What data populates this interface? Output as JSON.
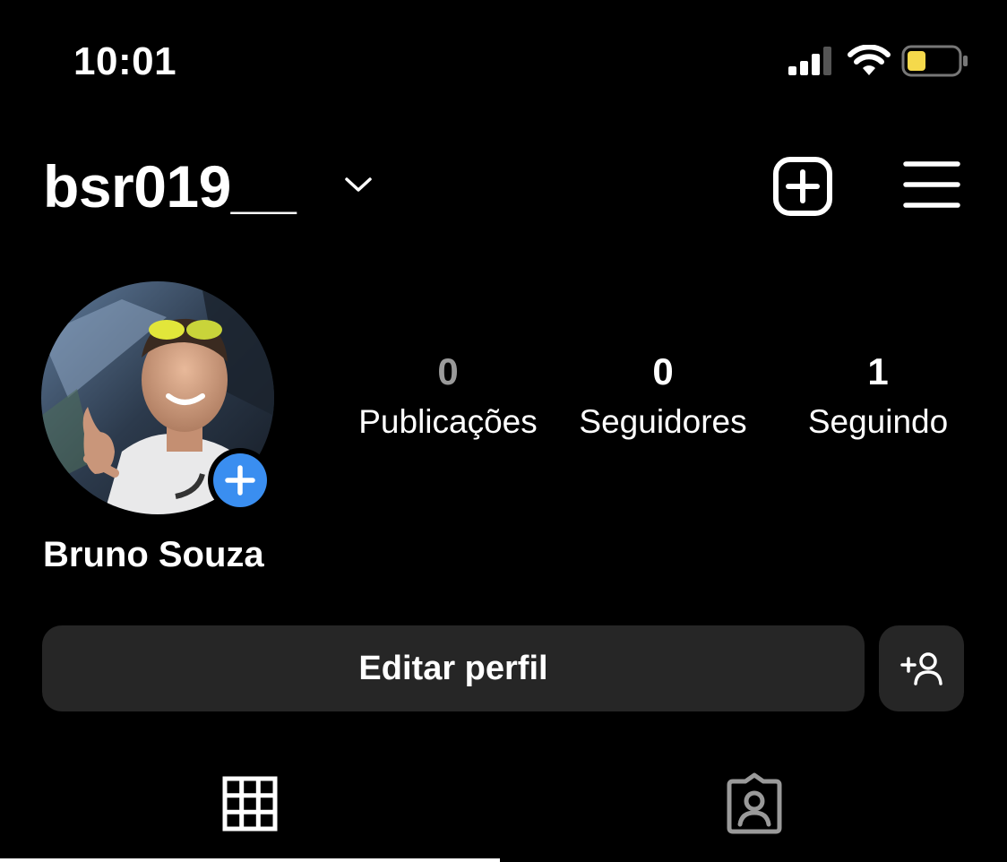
{
  "status_bar": {
    "time": "10:01",
    "signal_icon": "cellular-signal-icon",
    "wifi_icon": "wifi-icon",
    "battery_icon": "battery-low-icon",
    "battery_color": "#f5d94b"
  },
  "header": {
    "username": "bsr019__",
    "account_switcher_icon": "chevron-down-icon",
    "new_post_icon": "plus-square-icon",
    "menu_icon": "hamburger-menu-icon"
  },
  "profile": {
    "display_name": "Bruno Souza",
    "add_story_icon": "plus-icon",
    "add_story_color": "#3a8ef0",
    "stats": {
      "posts": {
        "count": "0",
        "label": "Publicações"
      },
      "followers": {
        "count": "0",
        "label": "Seguidores"
      },
      "following": {
        "count": "1",
        "label": "Seguindo"
      }
    }
  },
  "actions": {
    "edit_profile_label": "Editar perfil",
    "discover_people_icon": "add-person-icon",
    "button_color": "#262626"
  },
  "tabs": [
    {
      "icon": "grid-icon",
      "active": true
    },
    {
      "icon": "tagged-person-icon",
      "active": false
    }
  ]
}
